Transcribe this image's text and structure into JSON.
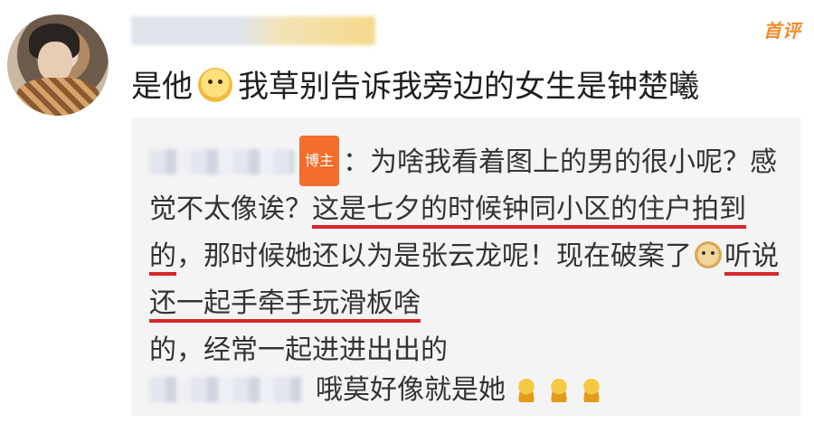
{
  "comment": {
    "first_badge": "首评",
    "text_before_emoji": "是他",
    "text_after_emoji": "我草别告诉我旁边的女生是钟楚曦",
    "emoji": "cat-emoji"
  },
  "reply": {
    "badge": "博主",
    "line_part1": "：为啥我看着图上的男的很小呢？感觉不太像诶？",
    "line_underlined1": "这是七夕的时候钟同小区的住户拍到的",
    "line_part2": "，那时候她还以为是张云龙呢！现在破案了",
    "emoji": "doge-emoji",
    "line_underlined2": "听说还一起手牵手玩滑板啥",
    "line_part3": "的，经常一起进进出出的"
  },
  "sub_reply": {
    "text": "哦莫好像就是她",
    "emoji": "sad-face-emoji",
    "emoji_count": 3
  },
  "colors": {
    "badge_orange": "#f36d2b",
    "first_badge": "#f08d2c",
    "underline_red": "#d9262b",
    "reply_bg": "#f4f4f4"
  }
}
